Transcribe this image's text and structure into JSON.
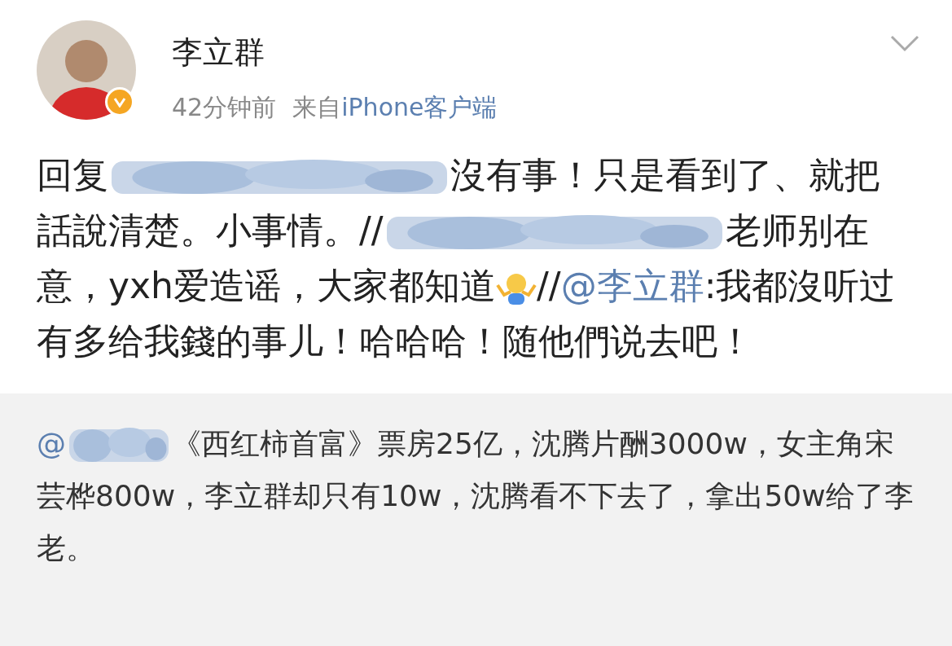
{
  "author": {
    "name": "李立群",
    "verified": true
  },
  "meta": {
    "time": "42分钟前",
    "source_prefix": "来自",
    "source": "iPhone客户端"
  },
  "post": {
    "segments": [
      {
        "kind": "text",
        "text": "回复"
      },
      {
        "kind": "redacted"
      },
      {
        "kind": "text",
        "text": "沒有事！只是看到了、就把話說清楚。小事情。//"
      },
      {
        "kind": "redacted"
      },
      {
        "kind": "text",
        "text": "老师别在意，yxh爱造谣，大家都知道"
      },
      {
        "kind": "emoji"
      },
      {
        "kind": "text",
        "text": "//"
      },
      {
        "kind": "mention",
        "text": "@李立群"
      },
      {
        "kind": "text",
        "text": ":我都沒听过有多给我錢的事儿！哈哈哈！随他們说去吧！"
      }
    ]
  },
  "repost": {
    "segments": [
      {
        "kind": "mention",
        "text": "@"
      },
      {
        "kind": "redacted"
      },
      {
        "kind": "text",
        "text": "《西红柿首富》票房25亿，沈腾片酬3000w，女主角宋芸桦800w，李立群却只有10w，沈腾看不下去了，拿出50w给了李老。"
      }
    ]
  }
}
